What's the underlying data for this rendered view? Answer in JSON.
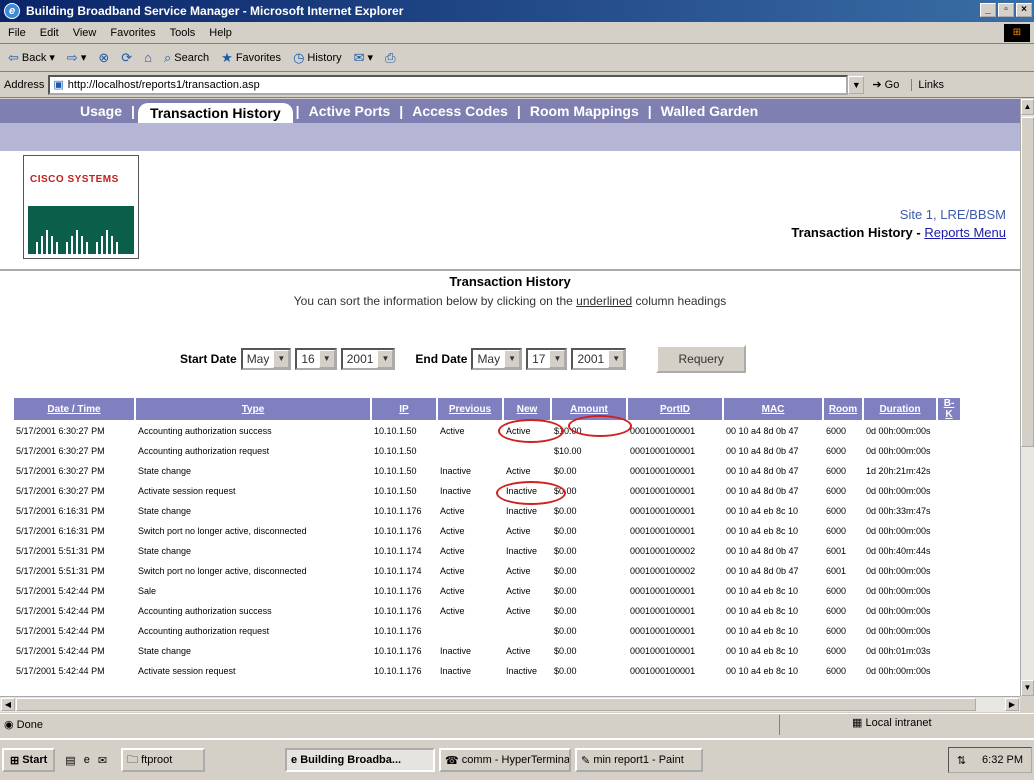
{
  "window": {
    "title": "Building Broadband Service Manager - Microsoft Internet Explorer"
  },
  "menu": [
    "File",
    "Edit",
    "View",
    "Favorites",
    "Tools",
    "Help"
  ],
  "toolbar": {
    "back": "Back",
    "search": "Search",
    "favorites": "Favorites",
    "history": "History"
  },
  "address": {
    "label": "Address",
    "url": "http://localhost/reports1/transaction.asp",
    "go": "Go",
    "links": "Links"
  },
  "nav": {
    "usage": "Usage",
    "transaction": "Transaction History",
    "ports": "Active Ports",
    "codes": "Access Codes",
    "rooms": "Room Mappings",
    "garden": "Walled Garden"
  },
  "header": {
    "logo": "CISCO SYSTEMS",
    "site": "Site 1, LRE/BBSM",
    "page": "Transaction History",
    "dash": " - ",
    "reports_link": "Reports Menu"
  },
  "section": {
    "title": "Transaction History",
    "sub_pre": "You can sort the information below by clicking on the ",
    "sub_u": "underlined",
    "sub_post": " column headings"
  },
  "filters": {
    "start_label": "Start Date",
    "start_month": "May",
    "start_day": "16",
    "start_year": "2001",
    "end_label": "End Date",
    "end_month": "May",
    "end_day": "17",
    "end_year": "2001",
    "requery": "Requery"
  },
  "table": {
    "headers": [
      "Date / Time",
      "Type",
      "IP",
      "Previous",
      "New",
      "Amount",
      "PortID",
      "MAC",
      "Room",
      "Duration",
      "B-K"
    ],
    "rows": [
      [
        "5/17/2001 6:30:27 PM",
        "Accounting authorization success",
        "10.10.1.50",
        "Active",
        "Active",
        "$10.00",
        "0001000100001",
        "00 10 a4 8d 0b 47",
        "6000",
        "0d 00h:00m:00s"
      ],
      [
        "5/17/2001 6:30:27 PM",
        "Accounting authorization request",
        "10.10.1.50",
        "",
        "",
        "$10.00",
        "0001000100001",
        "00 10 a4 8d 0b 47",
        "6000",
        "0d 00h:00m:00s"
      ],
      [
        "5/17/2001 6:30:27 PM",
        "State change",
        "10.10.1.50",
        "Inactive",
        "Active",
        "$0.00",
        "0001000100001",
        "00 10 a4 8d 0b 47",
        "6000",
        "1d 20h:21m:42s"
      ],
      [
        "5/17/2001 6:30:27 PM",
        "Activate session request",
        "10.10.1.50",
        "Inactive",
        "Inactive",
        "$0.00",
        "0001000100001",
        "00 10 a4 8d 0b 47",
        "6000",
        "0d 00h:00m:00s"
      ],
      [
        "5/17/2001 6:16:31 PM",
        "State change",
        "10.10.1.176",
        "Active",
        "Inactive",
        "$0.00",
        "0001000100001",
        "00 10 a4 eb 8c 10",
        "6000",
        "0d 00h:33m:47s"
      ],
      [
        "5/17/2001 6:16:31 PM",
        "Switch port no longer active, disconnected",
        "10.10.1.176",
        "Active",
        "Active",
        "$0.00",
        "0001000100001",
        "00 10 a4 eb 8c 10",
        "6000",
        "0d 00h:00m:00s"
      ],
      [
        "5/17/2001 5:51:31 PM",
        "State change",
        "10.10.1.174",
        "Active",
        "Inactive",
        "$0.00",
        "0001000100002",
        "00 10 a4 8d 0b 47",
        "6001",
        "0d 00h:40m:44s"
      ],
      [
        "5/17/2001 5:51:31 PM",
        "Switch port no longer active, disconnected",
        "10.10.1.174",
        "Active",
        "Active",
        "$0.00",
        "0001000100002",
        "00 10 a4 8d 0b 47",
        "6001",
        "0d 00h:00m:00s"
      ],
      [
        "5/17/2001 5:42:44 PM",
        "Sale",
        "10.10.1.176",
        "Active",
        "Active",
        "$0.00",
        "0001000100001",
        "00 10 a4 eb 8c 10",
        "6000",
        "0d 00h:00m:00s"
      ],
      [
        "5/17/2001 5:42:44 PM",
        "Accounting authorization success",
        "10.10.1.176",
        "Active",
        "Active",
        "$0.00",
        "0001000100001",
        "00 10 a4 eb 8c 10",
        "6000",
        "0d 00h:00m:00s"
      ],
      [
        "5/17/2001 5:42:44 PM",
        "Accounting authorization request",
        "10.10.1.176",
        "",
        "",
        "$0.00",
        "0001000100001",
        "00 10 a4 eb 8c 10",
        "6000",
        "0d 00h:00m:00s"
      ],
      [
        "5/17/2001 5:42:44 PM",
        "State change",
        "10.10.1.176",
        "Inactive",
        "Active",
        "$0.00",
        "0001000100001",
        "00 10 a4 eb 8c 10",
        "6000",
        "0d 00h:01m:03s"
      ],
      [
        "5/17/2001 5:42:44 PM",
        "Activate session request",
        "10.10.1.176",
        "Inactive",
        "Inactive",
        "$0.00",
        "0001000100001",
        "00 10 a4 eb 8c 10",
        "6000",
        "0d 00h:00m:00s"
      ]
    ]
  },
  "status": {
    "text": "Done",
    "zone": "Local intranet"
  },
  "taskbar": {
    "start": "Start",
    "tasks": [
      "ftproot",
      "Building Broadba...",
      "comm - HyperTerminal",
      "min report1 - Paint"
    ],
    "clock": "6:32 PM"
  }
}
